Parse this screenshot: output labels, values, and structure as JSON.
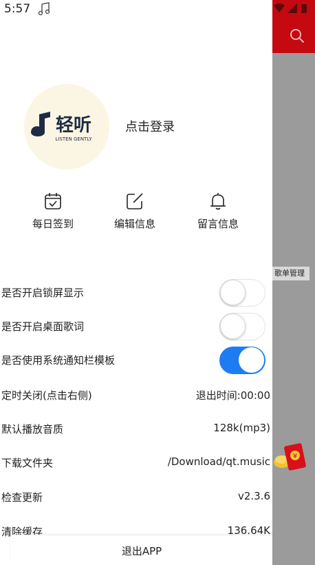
{
  "status_bar": {
    "time": "5:57"
  },
  "profile": {
    "logo_text": "轻听",
    "logo_subtext": "LISTEN GENTLY",
    "login_label": "点击登录"
  },
  "quick_actions": [
    {
      "label": "每日签到",
      "icon": "calendar-check-icon"
    },
    {
      "label": "编辑信息",
      "icon": "edit-icon"
    },
    {
      "label": "留言信息",
      "icon": "bell-icon"
    }
  ],
  "settings": [
    {
      "label": "是否开启锁屏显示",
      "toggle": false
    },
    {
      "label": "是否开启桌面歌词",
      "toggle": false
    },
    {
      "label": "是否使用系统通知栏模板",
      "toggle": true
    },
    {
      "label": "定时关闭(点击右侧)",
      "value": "退出时间:00:00"
    },
    {
      "label": "默认播放音质",
      "value": "128k(mp3)"
    },
    {
      "label": "下载文件夹",
      "value": "/Download/qt.music"
    },
    {
      "label": "检查更新",
      "value": "v2.3.6"
    },
    {
      "label": "清除缓存",
      "value": "136.64K"
    }
  ],
  "logout_label": "退出APP",
  "background": {
    "chip_label": "歌单管理",
    "header_color": "#c40a10"
  },
  "colors": {
    "toggle_on": "#1e7cf2",
    "avatar_bg": "#fbf6e3",
    "logo": "#1f2a44"
  }
}
